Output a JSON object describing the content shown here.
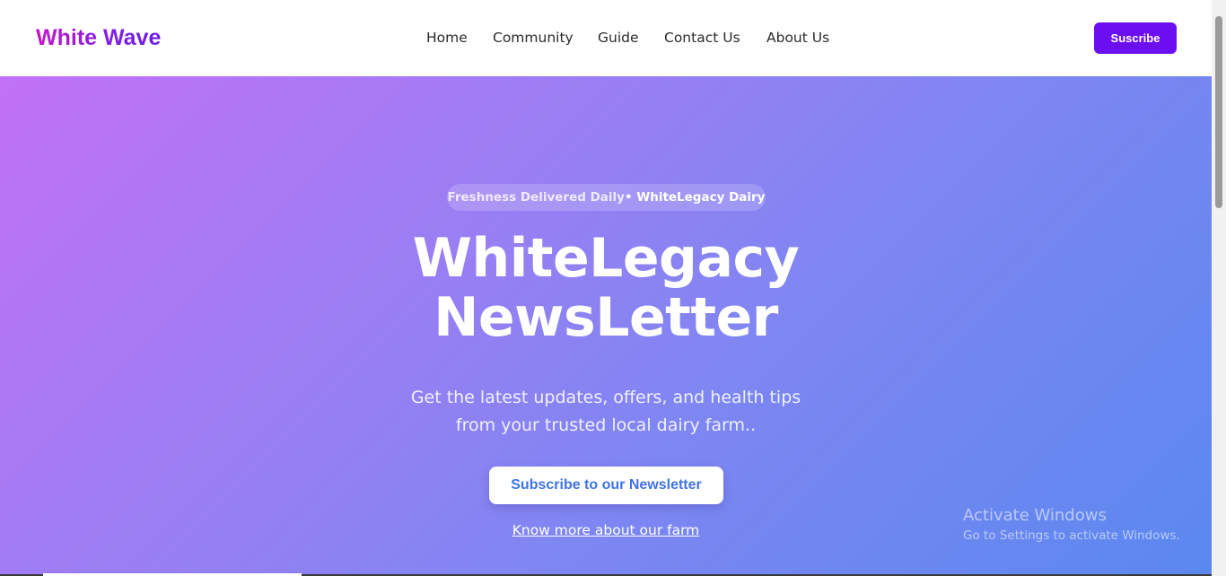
{
  "brand": {
    "logo": "White Wave"
  },
  "nav": {
    "items": [
      {
        "label": "Home"
      },
      {
        "label": "Community"
      },
      {
        "label": "Guide"
      },
      {
        "label": "Contact Us"
      },
      {
        "label": "About Us"
      }
    ],
    "cta_label": "Suscribe"
  },
  "hero": {
    "pill_muted": "Freshness Delivered Daily",
    "pill_strong": "• WhiteLegacy Dairy",
    "title_line1": "WhiteLegacy",
    "title_line2": "NewsLetter",
    "subtitle_line1": "Get the latest updates, offers, and health tips",
    "subtitle_line2": "from your trusted local dairy farm..",
    "subscribe_label": "Subscribe to our Newsletter",
    "link_label": "Know more about our farm"
  },
  "watermark": {
    "title": "Activate Windows",
    "subtitle": "Go to Settings to activate Windows."
  },
  "colors": {
    "brand_purple": "#6b0ff0",
    "gradient_start": "#c271f6",
    "gradient_end": "#5a88ef",
    "button_text_blue": "#3f73e6"
  }
}
